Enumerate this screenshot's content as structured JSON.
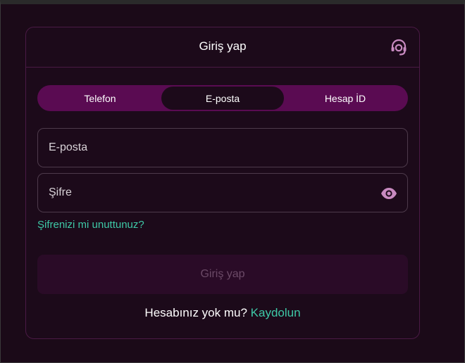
{
  "modal": {
    "title": "Giriş yap"
  },
  "icons": {
    "support": "headset-icon",
    "visibility": "eye-icon"
  },
  "tabs": [
    {
      "label": "Telefon",
      "active": false
    },
    {
      "label": "E-posta",
      "active": true
    },
    {
      "label": "Hesap İD",
      "active": false
    }
  ],
  "form": {
    "email_placeholder": "E-posta",
    "email_value": "",
    "password_placeholder": "Şifre",
    "password_value": "",
    "forgot_label": "Şifrenizi mi unuttunuz?",
    "submit_label": "Giriş yap"
  },
  "signup": {
    "prompt": "Hesabınız yok mu?",
    "link_label": "Kaydolun"
  },
  "colors": {
    "background": "#1c0a1a",
    "tab_bar": "#5a0b52",
    "accent_link": "#3ec9a7",
    "icon": "#c88ac0",
    "submit_disabled_bg": "#2a0b27",
    "submit_disabled_text": "#6b4a67"
  }
}
